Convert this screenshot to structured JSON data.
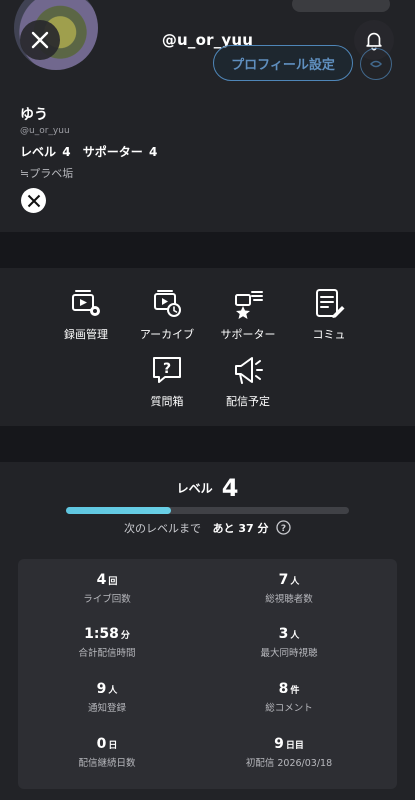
{
  "header": {
    "handle": "@u_or_yuu",
    "profile_settings_label": "プロフィール設定"
  },
  "profile": {
    "display_name": "ゆう",
    "user_id": "@u_or_yuu",
    "level_label": "レベル",
    "level_value": "4",
    "supporter_label": "サポーター",
    "supporter_value": "4",
    "tagline": "≒プラベ垢"
  },
  "menu": {
    "items": [
      {
        "label": "録画管理",
        "icon": "recording-manage-icon"
      },
      {
        "label": "アーカイブ",
        "icon": "archive-icon"
      },
      {
        "label": "サポーター",
        "icon": "supporter-icon"
      },
      {
        "label": "コミュ",
        "icon": "community-icon"
      },
      {
        "label": "質問箱",
        "icon": "question-box-icon"
      },
      {
        "label": "配信予定",
        "icon": "broadcast-schedule-icon"
      }
    ]
  },
  "level_panel": {
    "label": "レベル",
    "level": "4",
    "progress": 0.37,
    "next_level_label": "次のレベルまで",
    "remaining": "あと 37 分"
  },
  "stats": [
    {
      "value": "4",
      "unit": "回",
      "label": "ライブ回数"
    },
    {
      "value": "7",
      "unit": "人",
      "label": "総視聴者数"
    },
    {
      "value": "1:58",
      "unit": "分",
      "label": "合計配信時間"
    },
    {
      "value": "3",
      "unit": "人",
      "label": "最大同時視聴"
    },
    {
      "value": "9",
      "unit": "人",
      "label": "通知登録"
    },
    {
      "value": "8",
      "unit": "件",
      "label": "総コメント"
    },
    {
      "value": "0",
      "unit": "日",
      "label": "配信継続日数"
    },
    {
      "value": "9",
      "unit": "日目",
      "label": "初配信 2026/03/18"
    }
  ],
  "colors": {
    "background": "#16171b",
    "card": "#222327",
    "accent_blue": "#4f86b8",
    "progress": "#5fc6e0"
  }
}
